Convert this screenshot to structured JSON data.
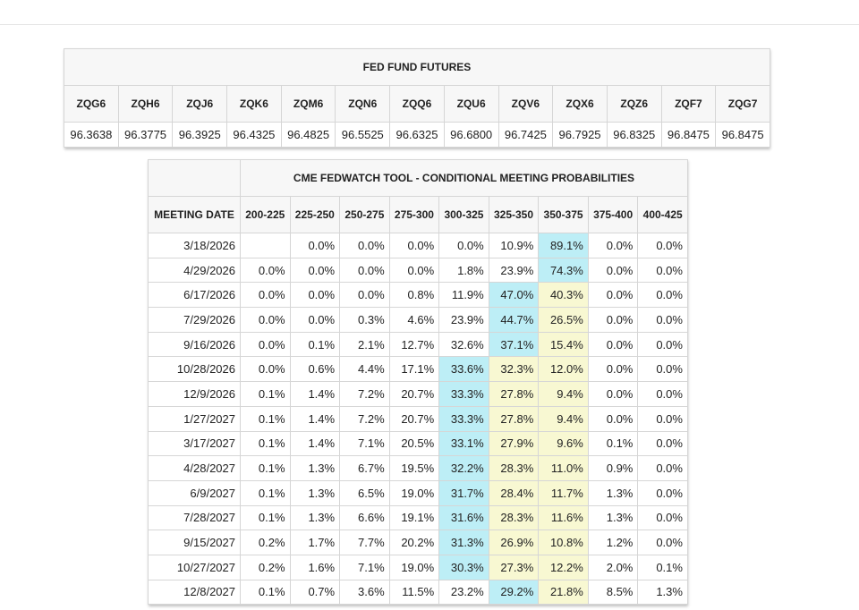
{
  "colors": {
    "highest_probability": "#bdeef6",
    "current_target_range": "#f8f8d2",
    "header_background": "#f7f7f7"
  },
  "futures": {
    "title": "FED FUND FUTURES",
    "columns": [
      "ZQG6",
      "ZQH6",
      "ZQJ6",
      "ZQK6",
      "ZQM6",
      "ZQN6",
      "ZQQ6",
      "ZQU6",
      "ZQV6",
      "ZQX6",
      "ZQZ6",
      "ZQF7",
      "ZQG7"
    ],
    "values": [
      "96.3638",
      "96.3775",
      "96.3925",
      "96.4325",
      "96.4825",
      "96.5525",
      "96.6325",
      "96.6800",
      "96.7425",
      "96.7925",
      "96.8325",
      "96.8475",
      "96.8475"
    ]
  },
  "probabilities": {
    "title": "CME FEDWATCH TOOL - CONDITIONAL MEETING PROBABILITIES",
    "date_header": "MEETING DATE",
    "columns": [
      "200-225",
      "225-250",
      "250-275",
      "275-300",
      "300-325",
      "325-350",
      "350-375",
      "375-400",
      "400-425"
    ],
    "rows": [
      {
        "date": "3/18/2026",
        "values": [
          "",
          "0.0%",
          "0.0%",
          "0.0%",
          "0.0%",
          "10.9%",
          "89.1%",
          "0.0%",
          "0.0%"
        ],
        "highlights": [
          "",
          "",
          "",
          "",
          "",
          "",
          "c",
          "",
          ""
        ]
      },
      {
        "date": "4/29/2026",
        "values": [
          "0.0%",
          "0.0%",
          "0.0%",
          "0.0%",
          "1.8%",
          "23.9%",
          "74.3%",
          "0.0%",
          "0.0%"
        ],
        "highlights": [
          "",
          "",
          "",
          "",
          "",
          "",
          "c",
          "",
          ""
        ]
      },
      {
        "date": "6/17/2026",
        "values": [
          "0.0%",
          "0.0%",
          "0.0%",
          "0.8%",
          "11.9%",
          "47.0%",
          "40.3%",
          "0.0%",
          "0.0%"
        ],
        "highlights": [
          "",
          "",
          "",
          "",
          "",
          "c",
          "y",
          "",
          ""
        ]
      },
      {
        "date": "7/29/2026",
        "values": [
          "0.0%",
          "0.0%",
          "0.3%",
          "4.6%",
          "23.9%",
          "44.7%",
          "26.5%",
          "0.0%",
          "0.0%"
        ],
        "highlights": [
          "",
          "",
          "",
          "",
          "",
          "c",
          "y",
          "",
          ""
        ]
      },
      {
        "date": "9/16/2026",
        "values": [
          "0.0%",
          "0.1%",
          "2.1%",
          "12.7%",
          "32.6%",
          "37.1%",
          "15.4%",
          "0.0%",
          "0.0%"
        ],
        "highlights": [
          "",
          "",
          "",
          "",
          "",
          "c",
          "y",
          "",
          ""
        ]
      },
      {
        "date": "10/28/2026",
        "values": [
          "0.0%",
          "0.6%",
          "4.4%",
          "17.1%",
          "33.6%",
          "32.3%",
          "12.0%",
          "0.0%",
          "0.0%"
        ],
        "highlights": [
          "",
          "",
          "",
          "",
          "c",
          "y",
          "y",
          "",
          ""
        ]
      },
      {
        "date": "12/9/2026",
        "values": [
          "0.1%",
          "1.4%",
          "7.2%",
          "20.7%",
          "33.3%",
          "27.8%",
          "9.4%",
          "0.0%",
          "0.0%"
        ],
        "highlights": [
          "",
          "",
          "",
          "",
          "c",
          "y",
          "y",
          "",
          ""
        ]
      },
      {
        "date": "1/27/2027",
        "values": [
          "0.1%",
          "1.4%",
          "7.2%",
          "20.7%",
          "33.3%",
          "27.8%",
          "9.4%",
          "0.0%",
          "0.0%"
        ],
        "highlights": [
          "",
          "",
          "",
          "",
          "c",
          "y",
          "y",
          "",
          ""
        ]
      },
      {
        "date": "3/17/2027",
        "values": [
          "0.1%",
          "1.4%",
          "7.1%",
          "20.5%",
          "33.1%",
          "27.9%",
          "9.6%",
          "0.1%",
          "0.0%"
        ],
        "highlights": [
          "",
          "",
          "",
          "",
          "c",
          "y",
          "y",
          "",
          ""
        ]
      },
      {
        "date": "4/28/2027",
        "values": [
          "0.1%",
          "1.3%",
          "6.7%",
          "19.5%",
          "32.2%",
          "28.3%",
          "11.0%",
          "0.9%",
          "0.0%"
        ],
        "highlights": [
          "",
          "",
          "",
          "",
          "c",
          "y",
          "y",
          "",
          ""
        ]
      },
      {
        "date": "6/9/2027",
        "values": [
          "0.1%",
          "1.3%",
          "6.5%",
          "19.0%",
          "31.7%",
          "28.4%",
          "11.7%",
          "1.3%",
          "0.0%"
        ],
        "highlights": [
          "",
          "",
          "",
          "",
          "c",
          "y",
          "y",
          "",
          ""
        ]
      },
      {
        "date": "7/28/2027",
        "values": [
          "0.1%",
          "1.3%",
          "6.6%",
          "19.1%",
          "31.6%",
          "28.3%",
          "11.6%",
          "1.3%",
          "0.0%"
        ],
        "highlights": [
          "",
          "",
          "",
          "",
          "c",
          "y",
          "y",
          "",
          ""
        ]
      },
      {
        "date": "9/15/2027",
        "values": [
          "0.2%",
          "1.7%",
          "7.7%",
          "20.2%",
          "31.3%",
          "26.9%",
          "10.8%",
          "1.2%",
          "0.0%"
        ],
        "highlights": [
          "",
          "",
          "",
          "",
          "c",
          "y",
          "y",
          "",
          ""
        ]
      },
      {
        "date": "10/27/2027",
        "values": [
          "0.2%",
          "1.6%",
          "7.1%",
          "19.0%",
          "30.3%",
          "27.3%",
          "12.2%",
          "2.0%",
          "0.1%"
        ],
        "highlights": [
          "",
          "",
          "",
          "",
          "c",
          "y",
          "y",
          "",
          ""
        ]
      },
      {
        "date": "12/8/2027",
        "values": [
          "0.1%",
          "0.7%",
          "3.6%",
          "11.5%",
          "23.2%",
          "29.2%",
          "21.8%",
          "8.5%",
          "1.3%"
        ],
        "highlights": [
          "",
          "",
          "",
          "",
          "",
          "c",
          "y",
          "",
          ""
        ]
      }
    ]
  }
}
